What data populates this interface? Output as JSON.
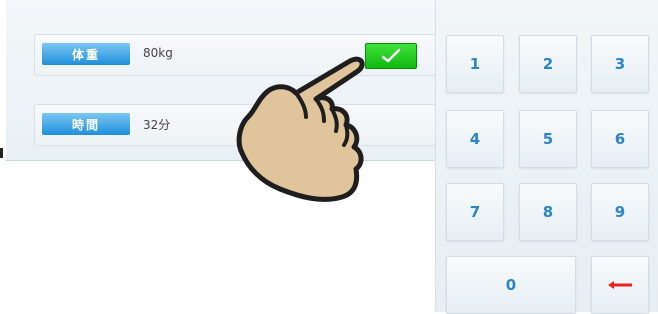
{
  "form": {
    "weight": {
      "label": "体重",
      "value": "80kg"
    },
    "time": {
      "label": "時間",
      "value": "32分"
    },
    "confirm_icon": "check-icon"
  },
  "keypad": {
    "keys": [
      "1",
      "2",
      "3",
      "4",
      "5",
      "6",
      "7",
      "8",
      "9"
    ],
    "zero": "0",
    "backspace_icon": "backspace-arrow-icon"
  },
  "overlay": {
    "icon": "pointing-hand-icon"
  },
  "colors": {
    "label_blue": "#1f8fdb",
    "confirm_green": "#1ec81b",
    "key_text": "#2c84c9",
    "backspace_red": "#e8231d"
  }
}
